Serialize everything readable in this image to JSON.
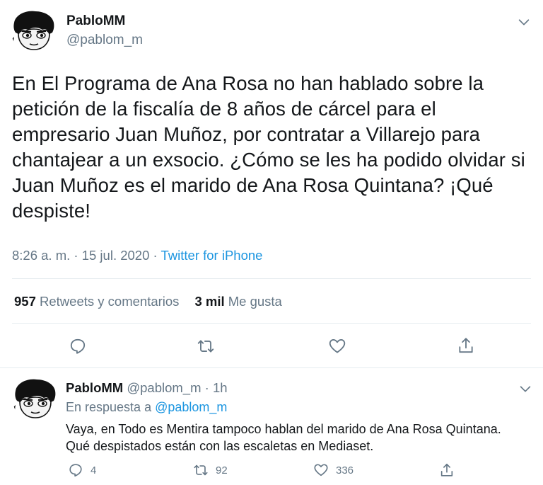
{
  "main_tweet": {
    "name": "PabloMM",
    "handle": "@pablom_m",
    "text": "En El Programa de Ana Rosa no han hablado sobre la petición de la fiscalía de 8 años de cárcel para el empresario Juan Muñoz, por contratar a Villarejo para chantajear a un exsocio. ¿Cómo se les ha podido olvidar si Juan Muñoz es el marido de Ana Rosa Quintana? ¡Qué despiste!",
    "time": "8:26 a. m.",
    "separator": " · ",
    "date": "15 jul. 2020",
    "source": "Twitter for iPhone",
    "retweets_count": "957",
    "retweets_label": "Retweets y comentarios",
    "likes_count": "3 mil",
    "likes_label": "Me gusta",
    "icons": [
      "reply-icon",
      "retweet-icon",
      "like-icon",
      "share-icon",
      "chevron-down-icon"
    ]
  },
  "reply_tweet": {
    "name": "PabloMM",
    "handle": "@pablom_m",
    "dot": "·",
    "time": "1h",
    "reply_to_label": "En respuesta a",
    "reply_to_handle": "@pablom_m",
    "text": "Vaya, en Todo es Mentira tampoco hablan del marido de Ana Rosa Quintana. Qué despistados están con las escaletas en Mediaset.",
    "replies": "4",
    "retweets": "92",
    "likes": "336"
  },
  "colors": {
    "text": "#14171a",
    "secondary": "#657786",
    "link": "#1b95e0",
    "divider": "#e6ecf0"
  }
}
